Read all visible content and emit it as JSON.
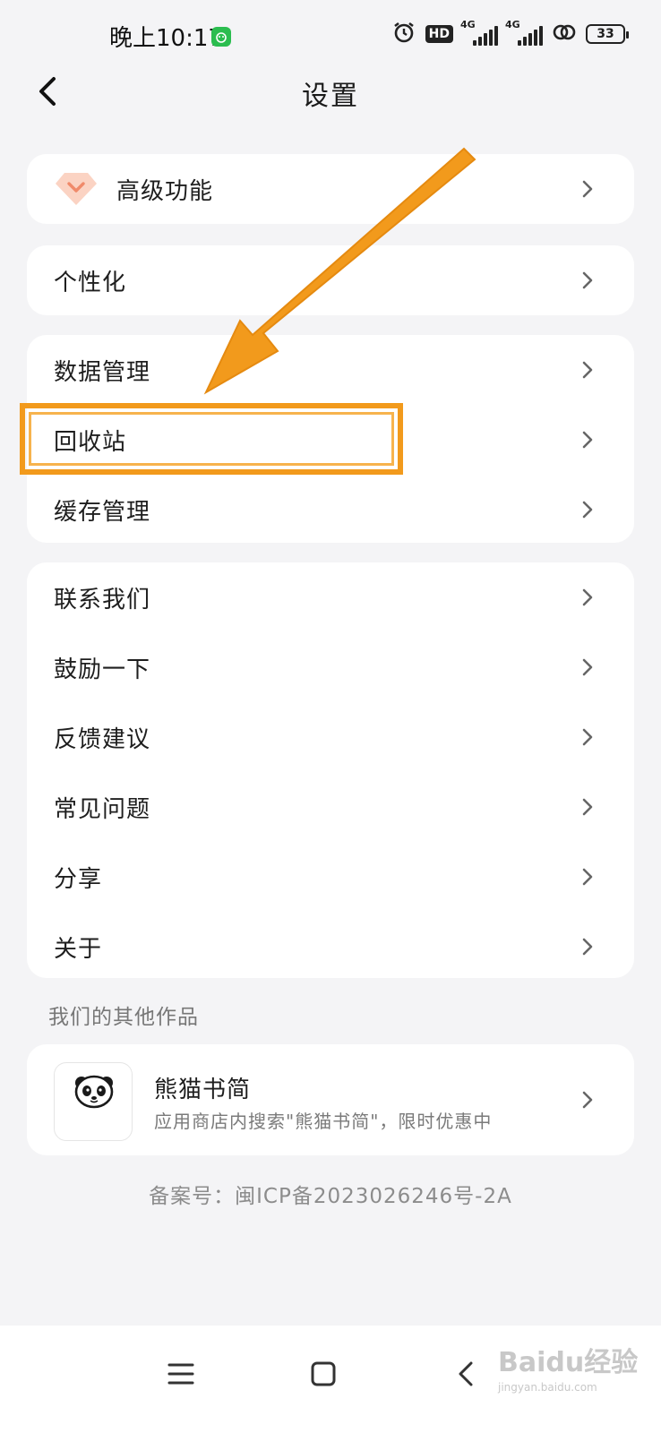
{
  "status_bar": {
    "time": "晚上10:17",
    "hd": "HD",
    "net1": "4G",
    "net2": "4G",
    "battery": "33"
  },
  "header": {
    "title": "设置"
  },
  "premium": {
    "label": "高级功能"
  },
  "personalize": {
    "label": "个性化"
  },
  "data_section": {
    "items": [
      {
        "label": "数据管理"
      },
      {
        "label": "回收站"
      },
      {
        "label": "缓存管理"
      }
    ]
  },
  "misc_section": {
    "items": [
      {
        "label": "联系我们"
      },
      {
        "label": "鼓励一下"
      },
      {
        "label": "反馈建议"
      },
      {
        "label": "常见问题"
      },
      {
        "label": "分享"
      },
      {
        "label": "关于"
      }
    ]
  },
  "other_works": {
    "section_label": "我们的其他作品",
    "product_name": "熊猫书简",
    "product_desc": "应用商店内搜索\"熊猫书简\"，限时优惠中"
  },
  "footer": {
    "icp": "备案号：闽ICP备2023026246号-2A"
  },
  "watermark": {
    "brand": "Baidu经验",
    "url": "jingyan.baidu.com"
  },
  "colors": {
    "accent_annotation": "#f29a1c",
    "premium_icon": "#f7b39a",
    "background": "#f4f4f6",
    "card": "#ffffff"
  }
}
